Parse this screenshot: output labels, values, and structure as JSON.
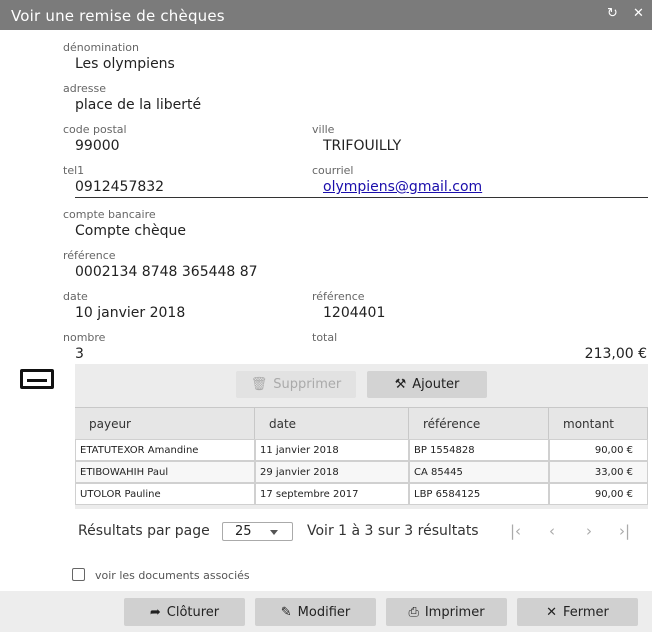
{
  "window": {
    "title": "Voir une remise de chèques"
  },
  "form": {
    "denomination": {
      "label": "dénomination",
      "value": "Les olympiens"
    },
    "adresse": {
      "label": "adresse",
      "value": "place de la liberté"
    },
    "code_postal": {
      "label": "code postal",
      "value": "99000"
    },
    "ville": {
      "label": "ville",
      "value": "TRIFOUILLY"
    },
    "tel1": {
      "label": "tel1",
      "value": "0912457832"
    },
    "courriel": {
      "label": "courriel",
      "value": "olympiens@gmail.com"
    },
    "compte_bancaire": {
      "label": "compte bancaire",
      "value": "Compte chèque"
    },
    "reference_compte": {
      "label": "référence",
      "value": "0002134 8748 365448 87"
    },
    "date": {
      "label": "date",
      "value": "10 janvier 2018"
    },
    "reference": {
      "label": "référence",
      "value": "1204401"
    },
    "nombre": {
      "label": "nombre",
      "value": "3"
    },
    "total": {
      "label": "total",
      "value": "213,00 €"
    }
  },
  "toolbar": {
    "delete_label": "Supprimer",
    "add_label": "Ajouter"
  },
  "table": {
    "headers": [
      "payeur",
      "date",
      "référence",
      "montant"
    ],
    "rows": [
      [
        "ETATUTEXOR Amandine",
        "11 janvier 2018",
        "BP 1554828",
        "90,00 €"
      ],
      [
        "ETIBOWAHIH Paul",
        "29 janvier 2018",
        "CA 85445",
        "33,00 €"
      ],
      [
        "UTOLOR Pauline",
        "17 septembre 2017",
        "LBP 6584125",
        "90,00 €"
      ]
    ]
  },
  "pagination": {
    "per_page_label": "Résultats par page",
    "per_page_value": "25",
    "summary": "Voir 1 à 3 sur 3 résultats"
  },
  "associated_docs": {
    "label": "voir les documents associés"
  },
  "footer": {
    "cloturer": "Clôturer",
    "modifier": "Modifier",
    "imprimer": "Imprimer",
    "fermer": "Fermer"
  }
}
